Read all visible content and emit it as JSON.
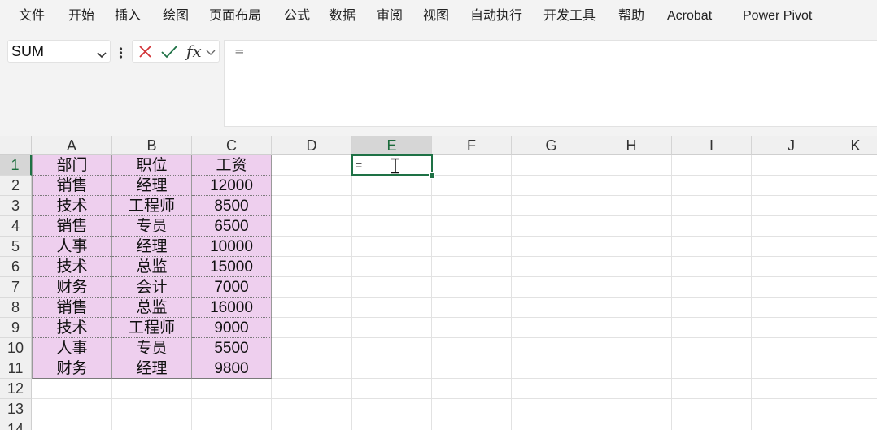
{
  "ribbon": {
    "tabs": [
      "文件",
      "开始",
      "插入",
      "绘图",
      "页面布局",
      "公式",
      "数据",
      "审阅",
      "视图",
      "自动执行",
      "开发工具",
      "帮助",
      "Acrobat",
      "Power Pivot"
    ]
  },
  "formula_bar": {
    "name_box": "SUM",
    "fx_label": "fx",
    "formula": "=",
    "icons": {
      "cancel": "close-icon",
      "enter": "check-icon",
      "insert_function": "fx-icon"
    }
  },
  "sheet": {
    "columns": [
      "A",
      "B",
      "C",
      "D",
      "E",
      "F",
      "G",
      "H",
      "I",
      "J",
      "K"
    ],
    "rows": [
      "1",
      "2",
      "3",
      "4",
      "5",
      "6",
      "7",
      "8",
      "9",
      "10",
      "11",
      "12",
      "13",
      "14"
    ],
    "active_cell": "E1",
    "active_cell_value": "=",
    "data_fill_color": "#eecfee",
    "selection_color": "#1e7145",
    "table": {
      "headers": [
        "部门",
        "职位",
        "工资"
      ],
      "rows": [
        [
          "销售",
          "经理",
          "12000"
        ],
        [
          "技术",
          "工程师",
          "8500"
        ],
        [
          "销售",
          "专员",
          "6500"
        ],
        [
          "人事",
          "经理",
          "10000"
        ],
        [
          "技术",
          "总监",
          "15000"
        ],
        [
          "财务",
          "会计",
          "7000"
        ],
        [
          "销售",
          "总监",
          "16000"
        ],
        [
          "技术",
          "工程师",
          "9000"
        ],
        [
          "人事",
          "专员",
          "5500"
        ],
        [
          "财务",
          "经理",
          "9800"
        ]
      ]
    }
  }
}
